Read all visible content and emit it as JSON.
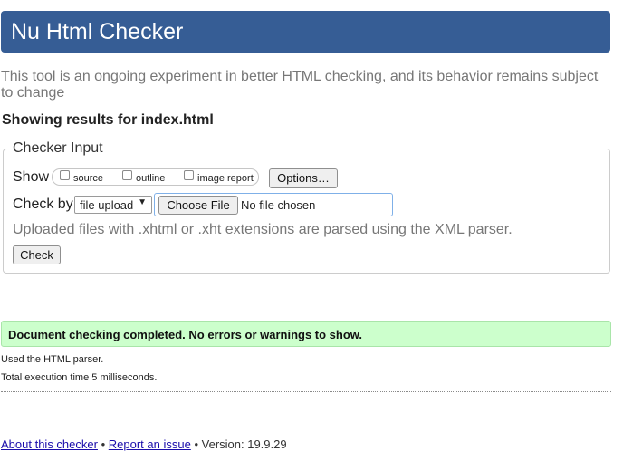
{
  "header": {
    "title": "Nu Html Checker"
  },
  "intro": "This tool is an ongoing experiment in better HTML checking, and its behavior remains subject to change",
  "showing_results": "Showing results for index.html",
  "checker_input": {
    "legend": "Checker Input",
    "show_label": "Show",
    "options": [
      {
        "label": "source",
        "checked": false
      },
      {
        "label": "outline",
        "checked": false
      },
      {
        "label": "image report",
        "checked": false
      }
    ],
    "options_button": "Options…",
    "check_by_label": "Check by",
    "check_by_value": "file upload",
    "choose_file_button": "Choose File",
    "no_file_text": "No file chosen",
    "hint": "Uploaded files with .xhtml or .xht extensions are parsed using the XML parser.",
    "check_button": "Check"
  },
  "result": {
    "message": "Document checking completed. No errors or warnings to show.",
    "parser_info": "Used the HTML parser.",
    "execution_time": "Total execution time 5 milliseconds."
  },
  "footer": {
    "about_link": "About this checker",
    "separator1": "•",
    "report_link": "Report an issue",
    "separator2": "•",
    "version": "Version: 19.9.29"
  },
  "colors": {
    "header_bg": "#365d95",
    "success_bg": "#ccffcc",
    "link": "#1a0dab"
  }
}
